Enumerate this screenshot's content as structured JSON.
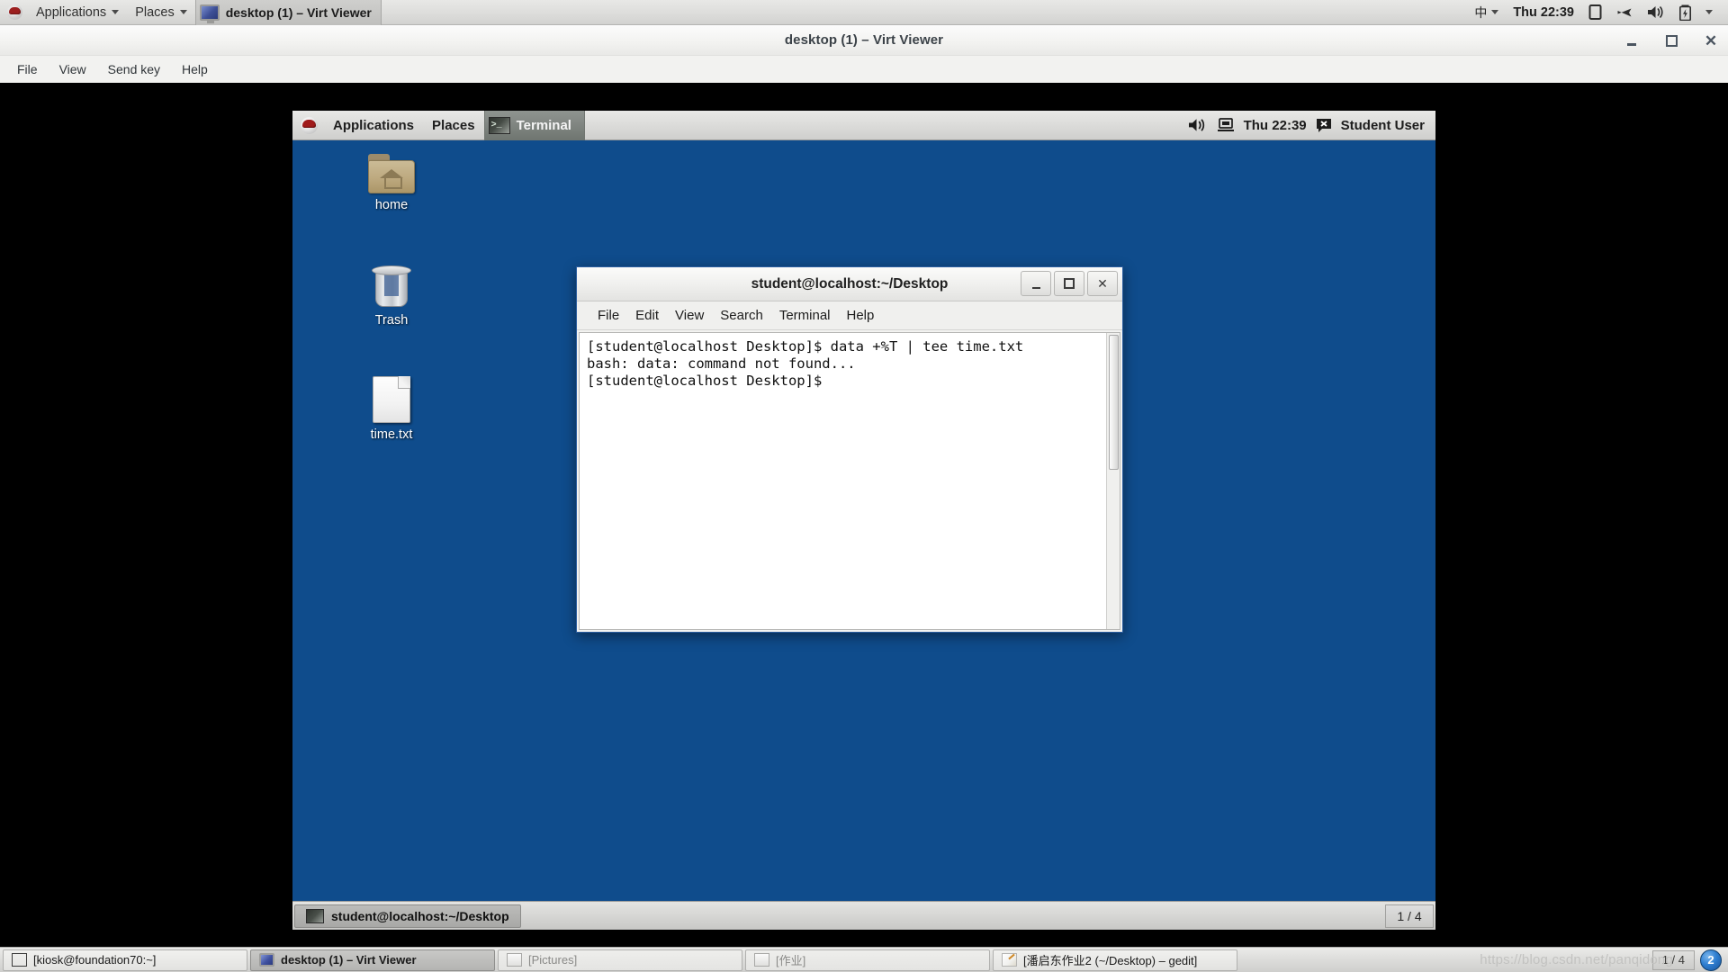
{
  "host_panel": {
    "logo_icon": "redhat-logo",
    "menus": [
      {
        "label": "Applications",
        "has_caret": true
      },
      {
        "label": "Places",
        "has_caret": true
      }
    ],
    "window_button": {
      "label": "desktop (1) – Virt Viewer",
      "icon": "monitor-icon"
    },
    "tray": {
      "input_method": "中",
      "clock": "Thu 22:39",
      "icons": [
        "display-icon",
        "airplane-mode-icon",
        "volume-icon",
        "battery-icon",
        "chevron-down-icon"
      ]
    }
  },
  "virt_viewer": {
    "title": "desktop (1) – Virt Viewer",
    "menus": [
      "File",
      "View",
      "Send key",
      "Help"
    ],
    "controls": {
      "minimize": "–",
      "maximize": "□",
      "close": "✕"
    }
  },
  "guest_panel": {
    "logo_icon": "redhat-logo",
    "menus": [
      "Applications",
      "Places"
    ],
    "window_button": {
      "label": "Terminal",
      "icon": "terminal-icon"
    },
    "tray": {
      "volume_icon": "volume-icon",
      "network_icon": "network-icon",
      "clock": "Thu 22:39",
      "message_icon": "message-icon",
      "user": "Student User"
    }
  },
  "desktop_icons": [
    {
      "label": "home",
      "icon": "home-folder-icon"
    },
    {
      "label": "Trash",
      "icon": "trash-icon"
    },
    {
      "label": "time.txt",
      "icon": "text-file-icon"
    }
  ],
  "terminal": {
    "title": "student@localhost:~/Desktop",
    "menus": [
      "File",
      "Edit",
      "View",
      "Search",
      "Terminal",
      "Help"
    ],
    "controls": {
      "minimize": "–",
      "maximize": "□",
      "close": "✕"
    },
    "content": "[student@localhost Desktop]$ data +%T | tee time.txt\nbash: data: command not found...\n[student@localhost Desktop]$ "
  },
  "guest_taskbar": {
    "task": {
      "label": "student@localhost:~/Desktop",
      "icon": "terminal-icon"
    },
    "workspace": "1 / 4"
  },
  "host_taskbar": {
    "tasks": [
      {
        "label": "[kiosk@foundation70:~]",
        "icon": "terminal-icon",
        "active": false,
        "dim": false
      },
      {
        "label": "desktop (1) – Virt Viewer",
        "icon": "monitor-icon",
        "active": true,
        "dim": false
      },
      {
        "label": "[Pictures]",
        "icon": "archive-icon",
        "active": false,
        "dim": true
      },
      {
        "label": "[作业]",
        "icon": "archive-icon",
        "active": false,
        "dim": true
      },
      {
        "label": "[潘启东作业2 (~/Desktop) – gedit]",
        "icon": "gedit-icon",
        "active": false,
        "dim": false
      }
    ],
    "watermark": "https://blog.csdn.net/panqidong",
    "workspace": "1 / 4",
    "badge": "2"
  },
  "colors": {
    "desktop_blue": "#0f4c8c",
    "panel_grey": "#dcdcda",
    "terminal_border": "#2a5d9f",
    "terminal_bg": "#ffffff"
  }
}
